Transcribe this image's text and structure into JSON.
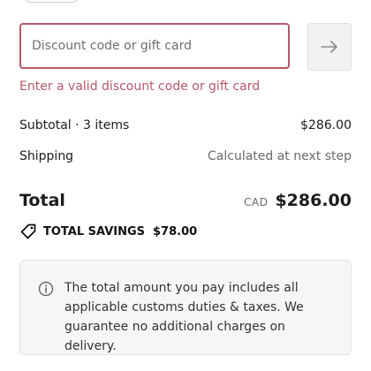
{
  "discount": {
    "placeholder": "Discount code or gift card",
    "value": "",
    "error": "Enter a valid discount code or gift card",
    "submit_icon": "arrow-right-icon"
  },
  "summary": {
    "subtotal_label": "Subtotal · 3 items",
    "subtotal_value": "$286.00",
    "shipping_label": "Shipping",
    "shipping_value": "Calculated at next step",
    "total_label": "Total",
    "currency": "CAD",
    "total_value": "$286.00",
    "savings_icon": "tag-icon",
    "savings_label": "TOTAL SAVINGS",
    "savings_value": "$78.00"
  },
  "notice": {
    "icon": "info-icon",
    "text": "The total amount you pay includes all applicable customs duties & taxes. We guarantee no additional charges on delivery."
  },
  "colors": {
    "error": "#b5596a",
    "button_bg": "#f2f2f2",
    "notice_bg": "#f6f6f6"
  }
}
